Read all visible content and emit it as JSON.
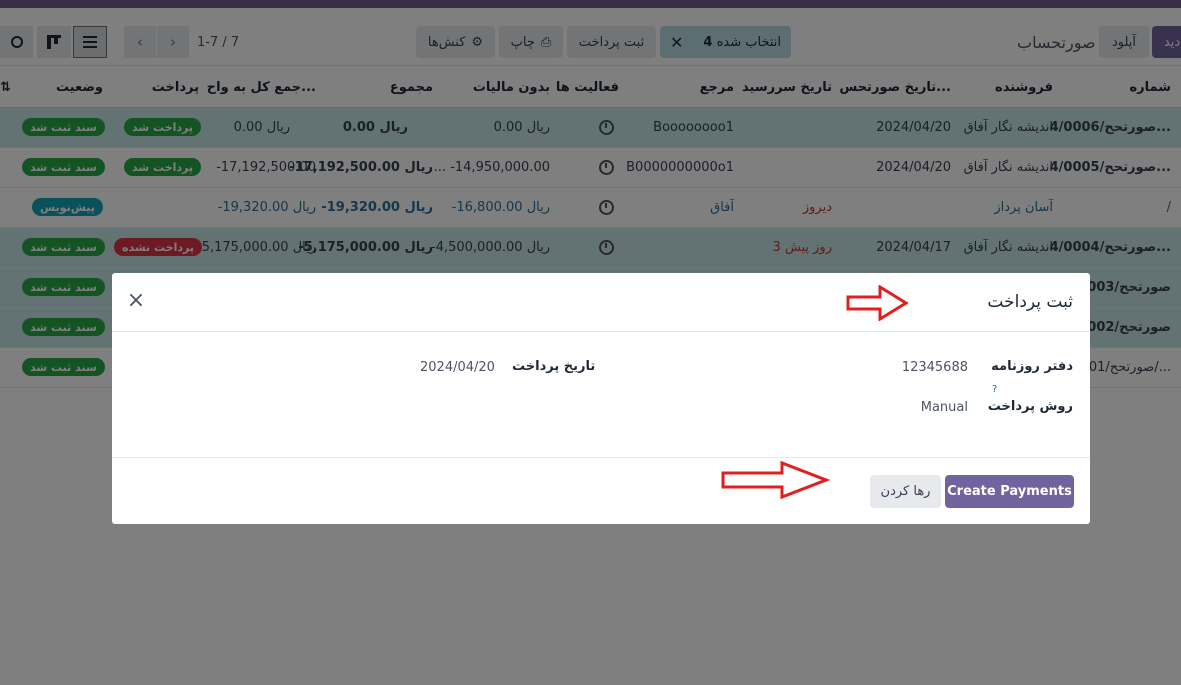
{
  "control_panel": {
    "new_label": "دید",
    "upload_label": "آپلود",
    "breadcrumb": "صورتحساب",
    "selected_count": "4",
    "selected_label": "انتخاب شده",
    "register_payment": "ثبت پرداخت",
    "print": "چاپ",
    "actions": "کنش‌ها",
    "pager": "1-7 / 7"
  },
  "table": {
    "headers": {
      "number": "شماره",
      "vendor": "فروشنده",
      "invoice_date": "تاریخ صورتحس...",
      "due_date": "تاریخ سررسید",
      "reference": "مرجع",
      "activities": "فعالیت ها",
      "untaxed": "بدون مالیات",
      "total": "مجموع",
      "total_currency": "جمع کل به واح...",
      "payment": "پرداخت",
      "status": "وضعیت"
    },
    "rows": [
      {
        "number": "صورتحح/4/0006...",
        "vendor": "اندیشه نگار آفاق",
        "invoice_date": "2024/04/20",
        "due_date": "",
        "reference": "Boooooooo1",
        "untaxed": "0.00 ریال",
        "total": "0.00 ریال",
        "total_currency": "0.00 ریال",
        "payment": "پرداخت شد",
        "status": "سند ثبت شد"
      },
      {
        "number": "صورتحح/4/0005...",
        "vendor": "اندیشه نگار آفاق",
        "invoice_date": "2024/04/20",
        "due_date": "",
        "reference": "B0000000000o1",
        "untaxed": "... -14,950,000.00",
        "total": "-17,192,500.00 ریال",
        "total_currency": "-17,192,500.00",
        "payment": "پرداخت شد",
        "status": "سند ثبت شد"
      },
      {
        "number": "/",
        "vendor": "آسان پرداز",
        "invoice_date": "",
        "due_date": "دیروز",
        "reference": "آفاق",
        "untaxed": "-16,800.00 ریال",
        "total": "-19,320.00 ریال",
        "total_currency": "-19,320.00 ریال",
        "payment": "",
        "status": "پیش‌نویس"
      },
      {
        "number": "صورتحح/4/0004...",
        "vendor": "اندیشه نگار آفاق",
        "invoice_date": "2024/04/17",
        "due_date": "3 روز پیش",
        "reference": "",
        "untaxed": "-4,500,000.00 ریال",
        "total": "-5,175,000.00 ریال",
        "total_currency": "-5,175,000.00 ریال",
        "payment": "پرداخت نشده",
        "status": "سند ثبت شد"
      },
      {
        "number": "صورتحح/0003",
        "status": "سند ثبت شد"
      },
      {
        "number": "صورتحح/0002",
        "status": "سند ثبت شد"
      },
      {
        "number": "صورتحح/0001/...",
        "status": "سند ثبت شد"
      }
    ]
  },
  "dialog": {
    "title": "ثبت پرداخت",
    "journal_label": "دفتر روزنامه",
    "journal_value": "12345688",
    "method_label": "روش پرداخت",
    "method_help": "?",
    "method_value": "Manual",
    "date_label": "تاریخ پرداخت",
    "date_value": "2024/04/20",
    "create_label": "Create Payments",
    "discard_label": "رها کردن"
  },
  "colors": {
    "primary": "#71639e",
    "arrow": "#e02020",
    "badge_green": "#28a745",
    "badge_red": "#dc3545",
    "badge_teal": "#17a2b8"
  }
}
